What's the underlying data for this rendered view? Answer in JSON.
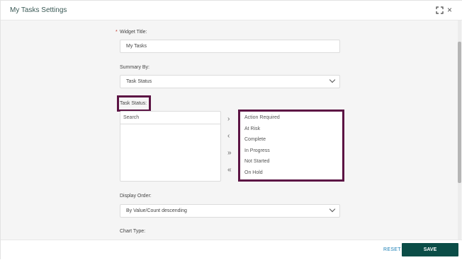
{
  "dialog": {
    "title": "My Tasks Settings"
  },
  "form": {
    "widget_title": {
      "required_mark": "*",
      "label": "Widget Title:",
      "value": "My Tasks"
    },
    "summary_by": {
      "label": "Summary By:",
      "value": "Task Status"
    },
    "task_status": {
      "label": "Task Status:",
      "search_placeholder": "Search",
      "available_items": [],
      "selected_items": [
        "Action Required",
        "At Risk",
        "Complete",
        "In Progress",
        "Not Started",
        "On Hold"
      ],
      "transfer_buttons": {
        "move_right": "›",
        "move_left": "‹",
        "move_all_right": "»",
        "move_all_left": "«"
      }
    },
    "display_order": {
      "label": "Display Order:",
      "value": "By Value/Count descending"
    },
    "chart_type": {
      "label": "Chart Type:"
    }
  },
  "footer": {
    "reset_label": "RESET",
    "save_label": "SAVE"
  },
  "colors": {
    "accent": "#0b4d47",
    "highlight": "#5c1444",
    "link": "#1a7fb5",
    "required": "#c0392b"
  },
  "icons": {
    "expand": "expand-icon",
    "close": "close-icon",
    "dropdown": "chevron-down-icon"
  }
}
